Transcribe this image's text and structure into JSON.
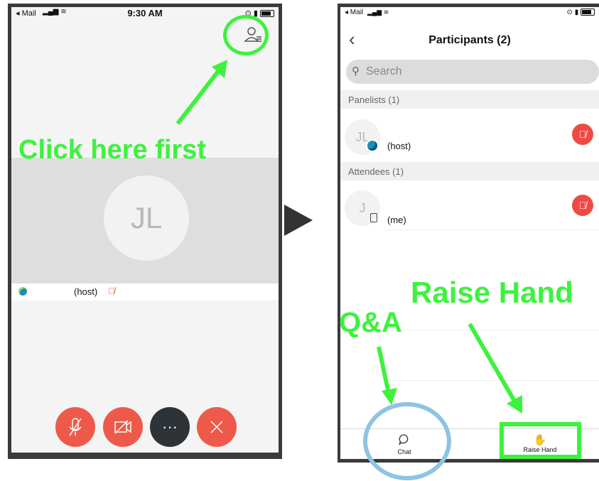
{
  "left_phone": {
    "status": {
      "left": "◂ Mail",
      "time": "9:30 AM"
    },
    "avatar_initials": "JL",
    "host_label": "(host)"
  },
  "annotations": {
    "click_here": "Click here first",
    "raise_hand": "Raise Hand",
    "qa": "Q&A"
  },
  "right_phone": {
    "status": {
      "left": "◂ Mail"
    },
    "title": "Participants (2)",
    "search_placeholder": "Search",
    "sections": [
      {
        "title": "Panelists (1)",
        "row": {
          "initials": "JL",
          "label": "(host)"
        }
      },
      {
        "title": "Attendees (1)",
        "row": {
          "initials": "J",
          "label": "(me)"
        }
      }
    ],
    "bottom": {
      "chat": "Chat",
      "raise_hand": "Raise Hand"
    }
  },
  "colors": {
    "accent_green": "#3df23d",
    "mute_red": "#ee5a4a",
    "circle_blue": "#8ec4e0"
  }
}
